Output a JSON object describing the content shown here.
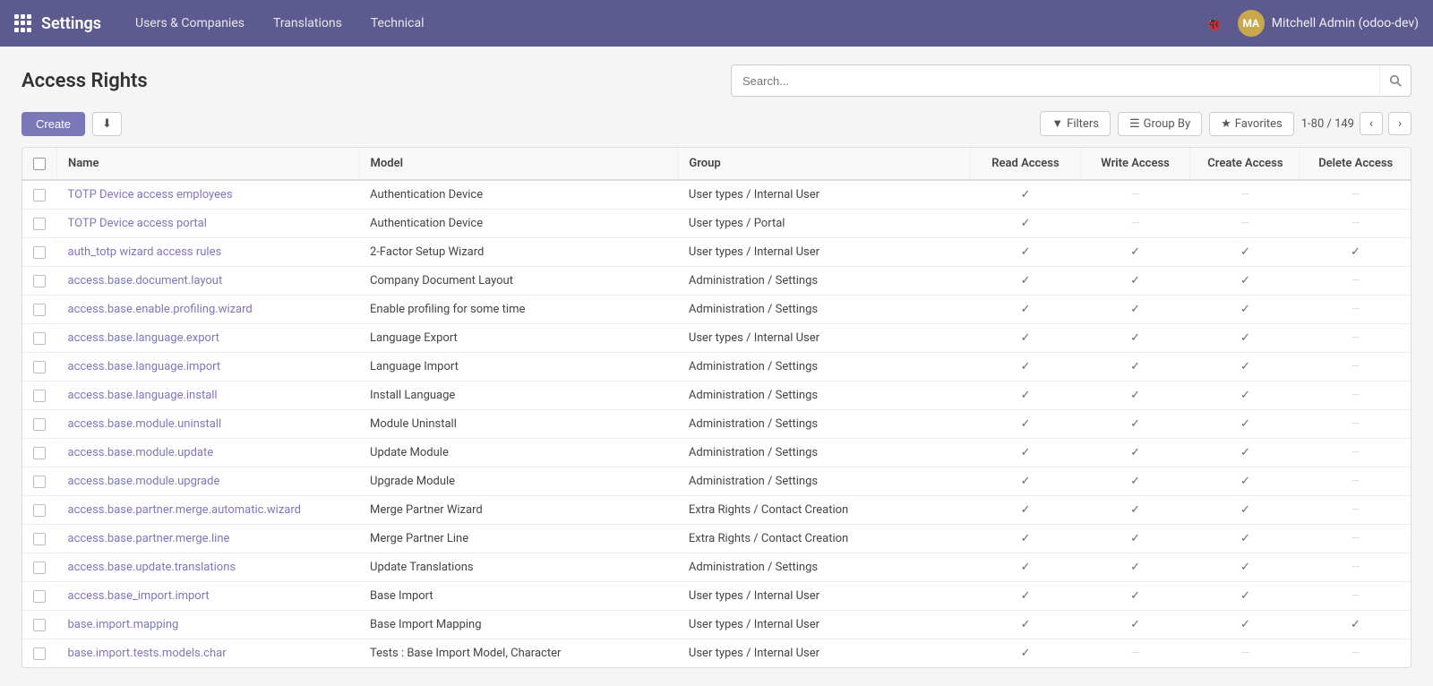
{
  "navbar": {
    "title": "Settings",
    "nav_items": [
      "Users & Companies",
      "Translations",
      "Technical"
    ],
    "user": "Mitchell Admin (odoo-dev)",
    "avatar_initials": "MA"
  },
  "page": {
    "title": "Access Rights",
    "search_placeholder": "Search...",
    "create_label": "Create",
    "download_icon": "⬇",
    "filters_label": "Filters",
    "groupby_label": "Group By",
    "favorites_label": "Favorites",
    "pagination": "1-80 / 149"
  },
  "table": {
    "columns": [
      "Name",
      "Model",
      "Group",
      "Read Access",
      "Write Access",
      "Create Access",
      "Delete Access"
    ],
    "rows": [
      {
        "name": "TOTP Device access employees",
        "model": "Authentication Device",
        "group": "User types / Internal User",
        "read": true,
        "write": false,
        "create": false,
        "delete": false
      },
      {
        "name": "TOTP Device access portal",
        "model": "Authentication Device",
        "group": "User types / Portal",
        "read": true,
        "write": false,
        "create": false,
        "delete": false
      },
      {
        "name": "auth_totp wizard access rules",
        "model": "2-Factor Setup Wizard",
        "group": "User types / Internal User",
        "read": true,
        "write": true,
        "create": true,
        "delete": true
      },
      {
        "name": "access.base.document.layout",
        "model": "Company Document Layout",
        "group": "Administration / Settings",
        "read": true,
        "write": true,
        "create": true,
        "delete": false
      },
      {
        "name": "access.base.enable.profiling.wizard",
        "model": "Enable profiling for some time",
        "group": "Administration / Settings",
        "read": true,
        "write": true,
        "create": true,
        "delete": false
      },
      {
        "name": "access.base.language.export",
        "model": "Language Export",
        "group": "User types / Internal User",
        "read": true,
        "write": true,
        "create": true,
        "delete": false
      },
      {
        "name": "access.base.language.import",
        "model": "Language Import",
        "group": "Administration / Settings",
        "read": true,
        "write": true,
        "create": true,
        "delete": false
      },
      {
        "name": "access.base.language.install",
        "model": "Install Language",
        "group": "Administration / Settings",
        "read": true,
        "write": true,
        "create": true,
        "delete": false
      },
      {
        "name": "access.base.module.uninstall",
        "model": "Module Uninstall",
        "group": "Administration / Settings",
        "read": true,
        "write": true,
        "create": true,
        "delete": false
      },
      {
        "name": "access.base.module.update",
        "model": "Update Module",
        "group": "Administration / Settings",
        "read": true,
        "write": true,
        "create": true,
        "delete": false
      },
      {
        "name": "access.base.module.upgrade",
        "model": "Upgrade Module",
        "group": "Administration / Settings",
        "read": true,
        "write": true,
        "create": true,
        "delete": false
      },
      {
        "name": "access.base.partner.merge.automatic.wizard",
        "model": "Merge Partner Wizard",
        "group": "Extra Rights / Contact Creation",
        "read": true,
        "write": true,
        "create": true,
        "delete": false
      },
      {
        "name": "access.base.partner.merge.line",
        "model": "Merge Partner Line",
        "group": "Extra Rights / Contact Creation",
        "read": true,
        "write": true,
        "create": true,
        "delete": false
      },
      {
        "name": "access.base.update.translations",
        "model": "Update Translations",
        "group": "Administration / Settings",
        "read": true,
        "write": true,
        "create": true,
        "delete": false
      },
      {
        "name": "access.base_import.import",
        "model": "Base Import",
        "group": "User types / Internal User",
        "read": true,
        "write": true,
        "create": true,
        "delete": false
      },
      {
        "name": "base.import.mapping",
        "model": "Base Import Mapping",
        "group": "User types / Internal User",
        "read": true,
        "write": true,
        "create": true,
        "delete": true
      },
      {
        "name": "base.import.tests.models.char",
        "model": "Tests : Base Import Model, Character",
        "group": "User types / Internal User",
        "read": true,
        "write": false,
        "create": false,
        "delete": false
      }
    ]
  }
}
